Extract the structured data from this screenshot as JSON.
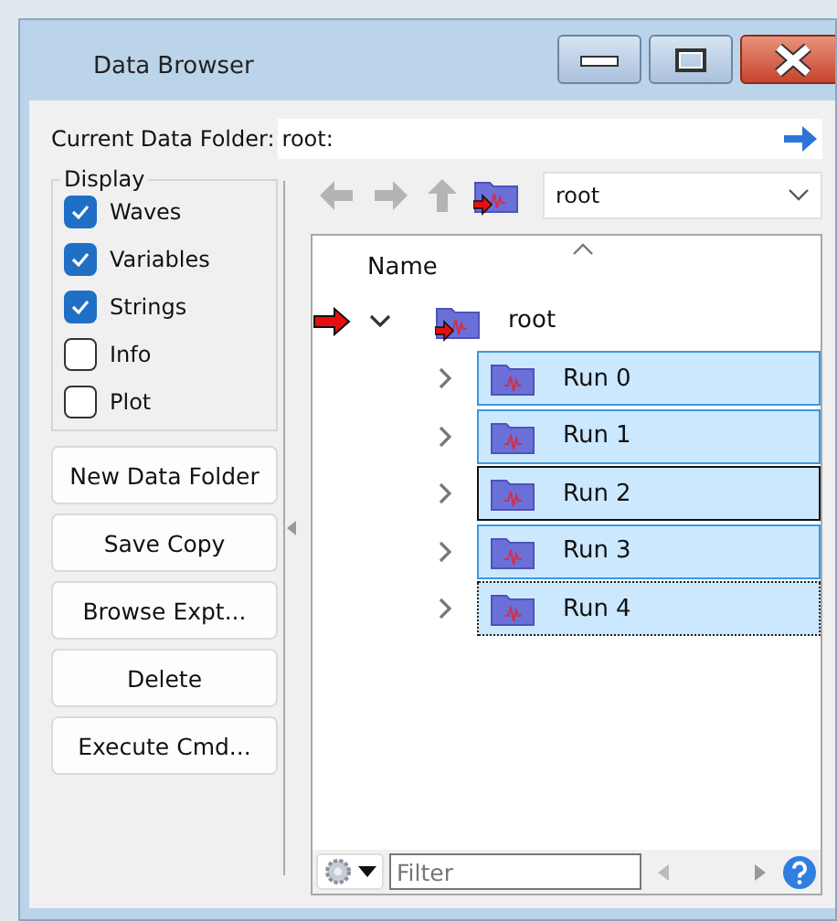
{
  "window": {
    "title": "Data Browser"
  },
  "current_folder": {
    "label": "Current Data Folder:",
    "value": "root:"
  },
  "display": {
    "title": "Display",
    "options": [
      {
        "label": "Waves",
        "checked": true
      },
      {
        "label": "Variables",
        "checked": true
      },
      {
        "label": "Strings",
        "checked": true
      },
      {
        "label": "Info",
        "checked": false
      },
      {
        "label": "Plot",
        "checked": false
      }
    ]
  },
  "buttons": [
    "New Data Folder",
    "Save Copy",
    "Browse Expt...",
    "Delete",
    "Execute Cmd..."
  ],
  "toolbar": {
    "back_disabled": true,
    "forward_disabled": true,
    "up_disabled": true,
    "folder_select": "root"
  },
  "tree": {
    "column": "Name",
    "items": [
      {
        "name": "root",
        "current": true,
        "expanded": true,
        "selected": false,
        "children": [
          {
            "name": "Run 0",
            "expanded": false,
            "selected": true,
            "hover": false,
            "focused": false
          },
          {
            "name": "Run 1",
            "expanded": false,
            "selected": true,
            "hover": false,
            "focused": false
          },
          {
            "name": "Run 2",
            "expanded": false,
            "selected": true,
            "hover": true,
            "focused": false
          },
          {
            "name": "Run 3",
            "expanded": false,
            "selected": true,
            "hover": false,
            "focused": false
          },
          {
            "name": "Run 4",
            "expanded": false,
            "selected": true,
            "hover": false,
            "focused": true
          }
        ]
      }
    ]
  },
  "filter": {
    "placeholder": "Filter"
  }
}
